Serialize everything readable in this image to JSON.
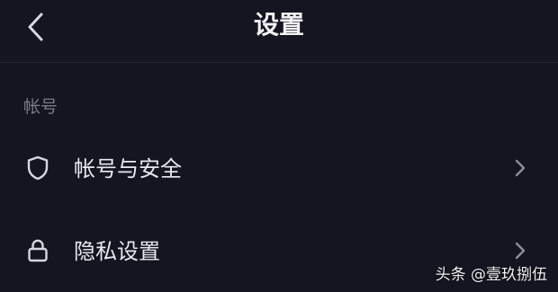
{
  "header": {
    "title": "设置",
    "back_icon": "chevron-left-icon"
  },
  "section": {
    "label": "帐号"
  },
  "items": [
    {
      "label": "帐号与安全",
      "icon": "shield-icon",
      "chevron_icon": "chevron-right-icon"
    },
    {
      "label": "隐私设置",
      "icon": "lock-icon",
      "chevron_icon": "chevron-right-icon"
    }
  ],
  "watermark": {
    "text": "头条 @壹玖捌伍"
  },
  "colors": {
    "background": "#141520",
    "text": "#e8e8ee",
    "muted": "#7a7b86",
    "divider": "#262733"
  }
}
